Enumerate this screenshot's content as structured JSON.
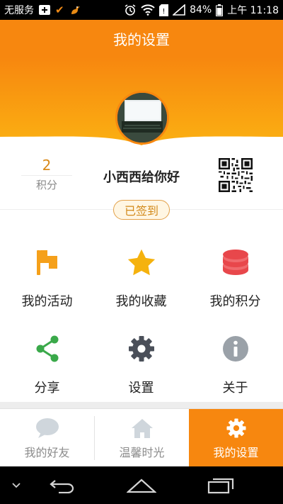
{
  "status_bar": {
    "carrier": "无服务",
    "battery": "84%",
    "time": "上午 11:18"
  },
  "header": {
    "title": "我的设置"
  },
  "profile": {
    "points_value": "2",
    "points_label": "积分",
    "username": "小西西给你好",
    "signin_badge": "已签到"
  },
  "menu": {
    "items": [
      {
        "label": "我的活动",
        "icon": "flag-icon",
        "color": "#f5a01a"
      },
      {
        "label": "我的收藏",
        "icon": "star-icon",
        "color": "#f5b20e"
      },
      {
        "label": "我的积分",
        "icon": "coins-icon",
        "color": "#e8474b"
      },
      {
        "label": "分享",
        "icon": "share-icon",
        "color": "#3aa94a"
      },
      {
        "label": "设置",
        "icon": "gear-icon",
        "color": "#4a4f59"
      },
      {
        "label": "关于",
        "icon": "info-icon",
        "color": "#9aa1a8"
      }
    ]
  },
  "tabs": [
    {
      "label": "我的好友",
      "icon": "chat-bubble-icon"
    },
    {
      "label": "温馨时光",
      "icon": "home-icon"
    },
    {
      "label": "我的设置",
      "icon": "gear-icon",
      "active": true
    }
  ],
  "colors": {
    "accent": "#f7870f",
    "badge_text": "#d2891a"
  }
}
